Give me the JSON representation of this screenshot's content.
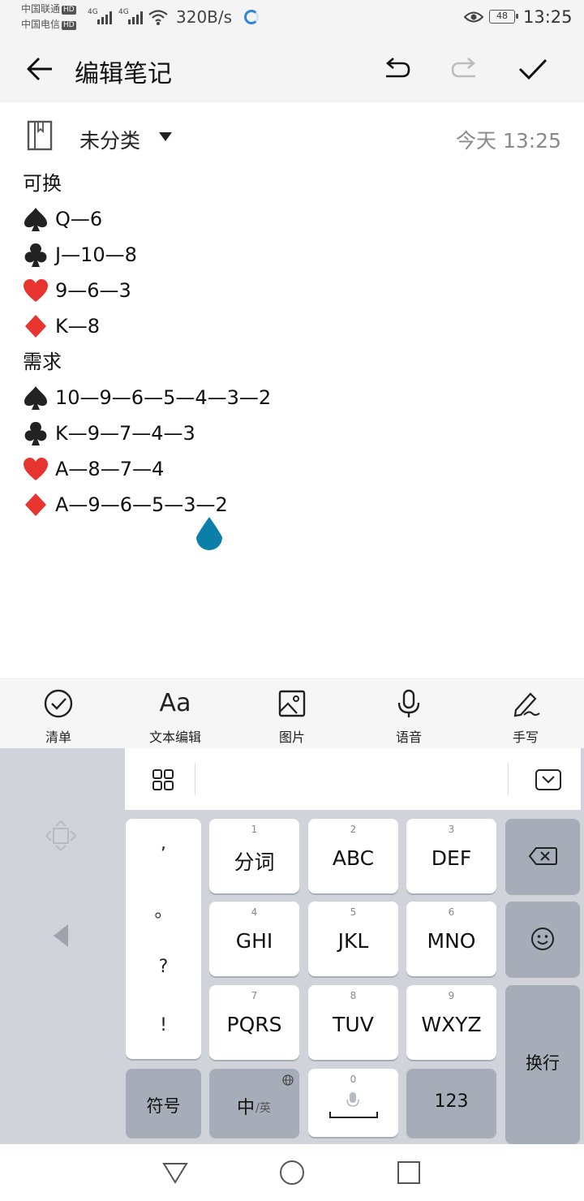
{
  "status_bar": {
    "carrier1": "中国联通",
    "carrier2": "中国电信",
    "hd": "HD",
    "net1": "4G",
    "net2": "4G",
    "speed": "320B/s",
    "battery": "48",
    "time": "13:25"
  },
  "toolbar": {
    "title": "编辑笔记",
    "back_icon": "arrow-left-icon",
    "undo_icon": "undo-icon",
    "redo_icon": "redo-icon",
    "confirm_icon": "check-icon"
  },
  "note": {
    "category": "未分类",
    "time": "今天 13:25",
    "lines": [
      {
        "suit": "",
        "text": "可换"
      },
      {
        "suit": "spade",
        "text": "Q—6"
      },
      {
        "suit": "club",
        "text": "J—10—8"
      },
      {
        "suit": "heart",
        "text": "9—6—3"
      },
      {
        "suit": "diamond",
        "text": "K—8"
      },
      {
        "suit": "",
        "text": "需求"
      },
      {
        "suit": "spade",
        "text": "10—9—6—5—4—3—2"
      },
      {
        "suit": "club",
        "text": "K—9—7—4—3"
      },
      {
        "suit": "heart",
        "text": "A—8—7—4"
      },
      {
        "suit": "diamond",
        "text": "A—9—6—5—3—2"
      }
    ]
  },
  "tools": {
    "checklist": "清单",
    "text_edit": "文本编辑",
    "text_edit_glyph": "Aa",
    "image": "图片",
    "voice": "语音",
    "handwrite": "手写"
  },
  "keyboard": {
    "punct": [
      ",",
      "。",
      "?",
      "!"
    ],
    "keys": [
      {
        "num": "1",
        "label": "分词"
      },
      {
        "num": "2",
        "label": "ABC"
      },
      {
        "num": "3",
        "label": "DEF"
      },
      {
        "num": "4",
        "label": "GHI"
      },
      {
        "num": "5",
        "label": "JKL"
      },
      {
        "num": "6",
        "label": "MNO"
      },
      {
        "num": "7",
        "label": "PQRS"
      },
      {
        "num": "8",
        "label": "TUV"
      },
      {
        "num": "9",
        "label": "WXYZ"
      }
    ],
    "symbol": "符号",
    "lang_main": "中",
    "lang_sub": "/英",
    "space_num": "0",
    "num_key": "123",
    "enter": "换行"
  },
  "colors": {
    "suit_black": "#222222",
    "suit_red": "#e8342f",
    "cursor": "#0b7fa8"
  }
}
